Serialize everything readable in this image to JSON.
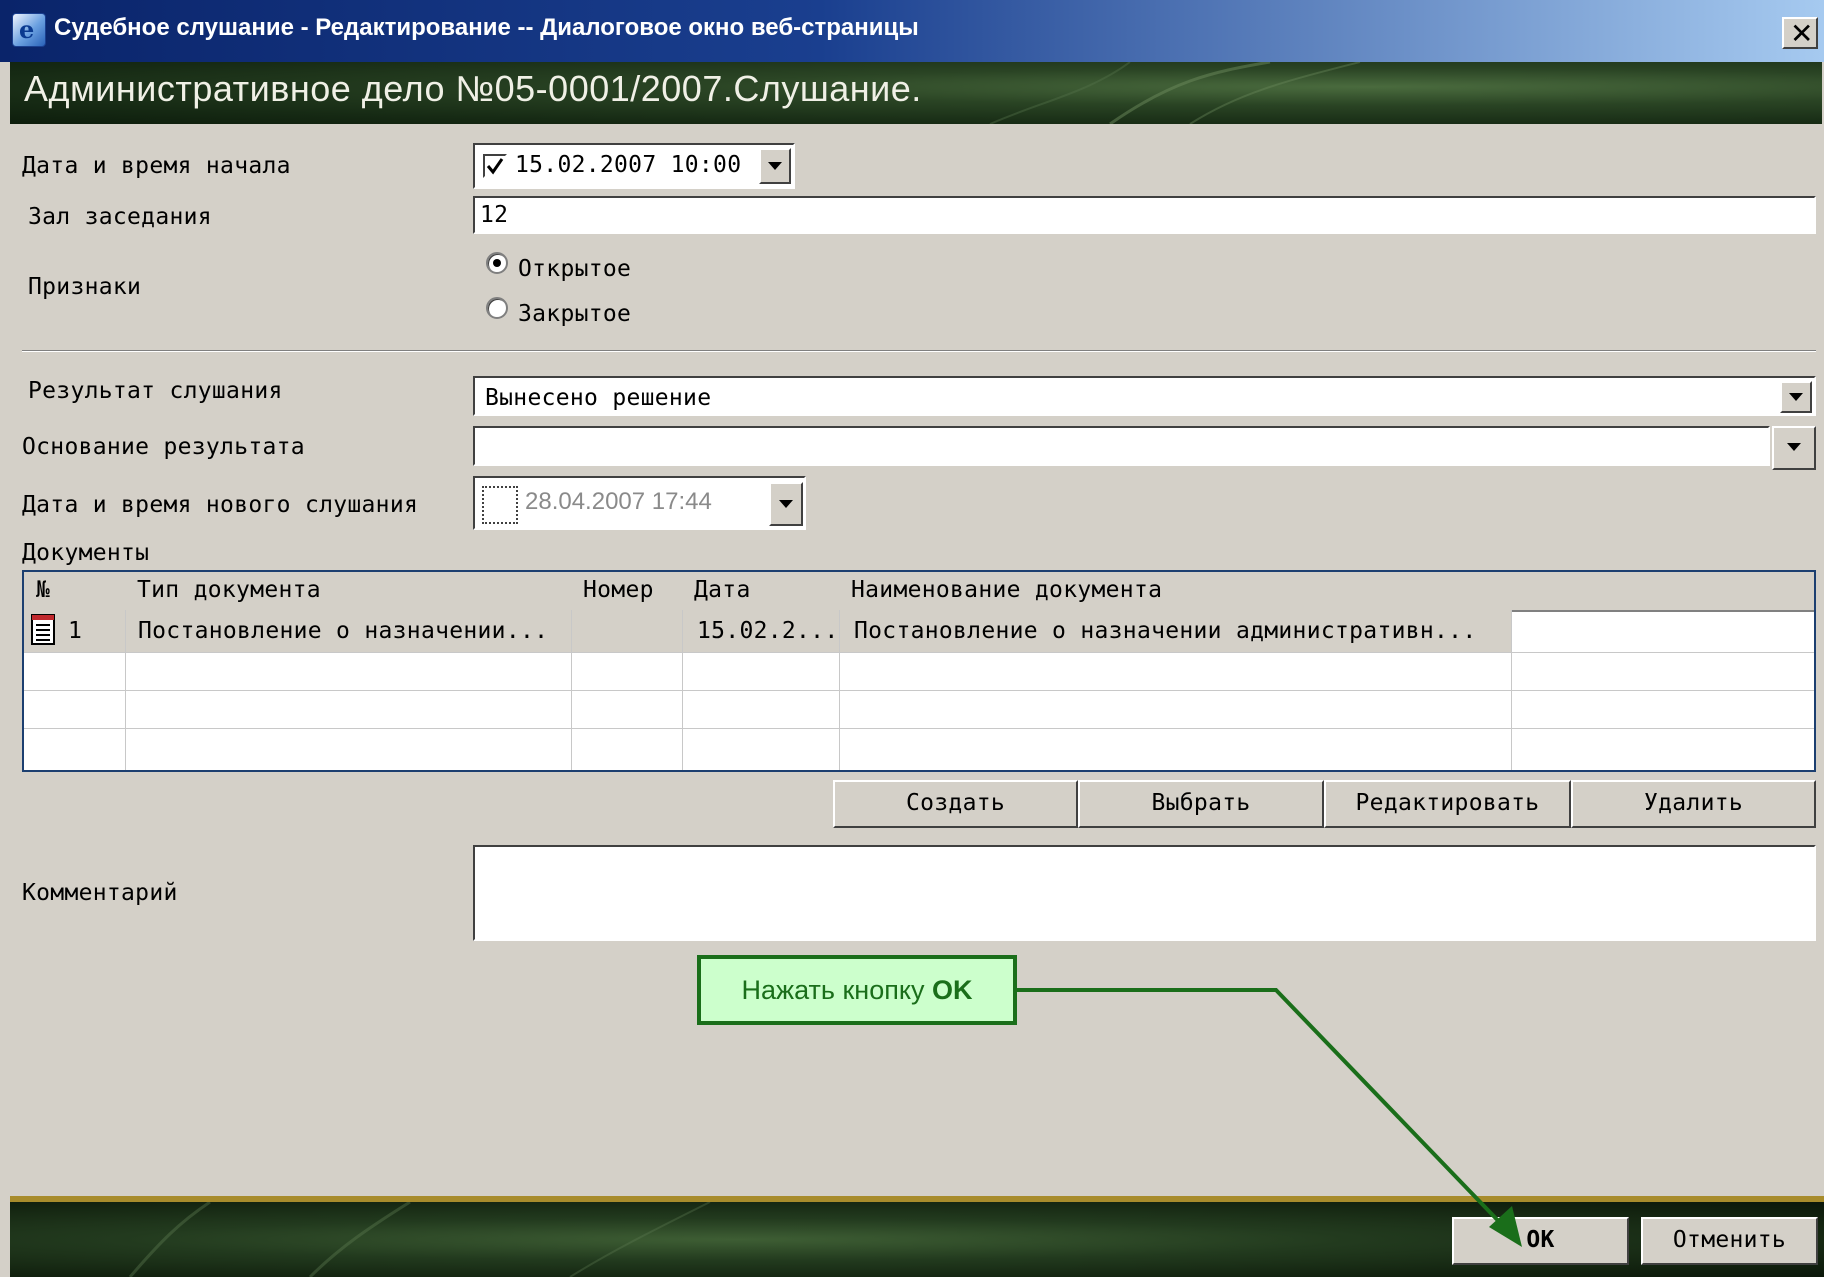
{
  "window": {
    "title": "Судебное слушание - Редактирование -- Диалоговое окно веб-страницы",
    "close_glyph": "✕"
  },
  "header": {
    "title": "Административное дело №05-0001/2007.Слушание."
  },
  "form": {
    "start_datetime": {
      "label": "Дата и время начала",
      "value": "15.02.2007 10:00",
      "checked": true
    },
    "hall": {
      "label": "Зал заседания",
      "value": "12"
    },
    "attributes": {
      "label": "Признаки",
      "options": [
        {
          "label": "Открытое",
          "selected": true
        },
        {
          "label": "Закрытое",
          "selected": false
        }
      ]
    },
    "result": {
      "label": "Результат слушания",
      "value": "Вынесено решение"
    },
    "result_basis": {
      "label": "Основание результата",
      "value": ""
    },
    "new_datetime": {
      "label": "Дата и время нового слушания",
      "value": "28.04.2007 17:44",
      "checked": false
    },
    "documents": {
      "label": "Документы",
      "columns": [
        "№",
        "Тип документа",
        "Номер",
        "Дата",
        "Наименование документа"
      ],
      "rows": [
        {
          "num": "1",
          "type": "Постановление о назначении...",
          "number": "",
          "date": "15.02.2...",
          "name": "Постановление о назначении административн..."
        }
      ]
    },
    "document_buttons": {
      "create": "Создать",
      "select": "Выбрать",
      "edit": "Редактировать",
      "delete": "Удалить"
    },
    "comment": {
      "label": "Комментарий",
      "value": ""
    }
  },
  "callout": {
    "text_prefix": "Нажать кнопку ",
    "text_bold": "OK"
  },
  "footer": {
    "ok": "OK",
    "cancel": "Отменить"
  },
  "colors": {
    "titlebar": "#0a246a",
    "dialog_bg": "#d4d0c8",
    "callout_bg": "#ccffcc",
    "callout_border": "#1a6e1a",
    "footer_accent": "#a88c2c"
  }
}
